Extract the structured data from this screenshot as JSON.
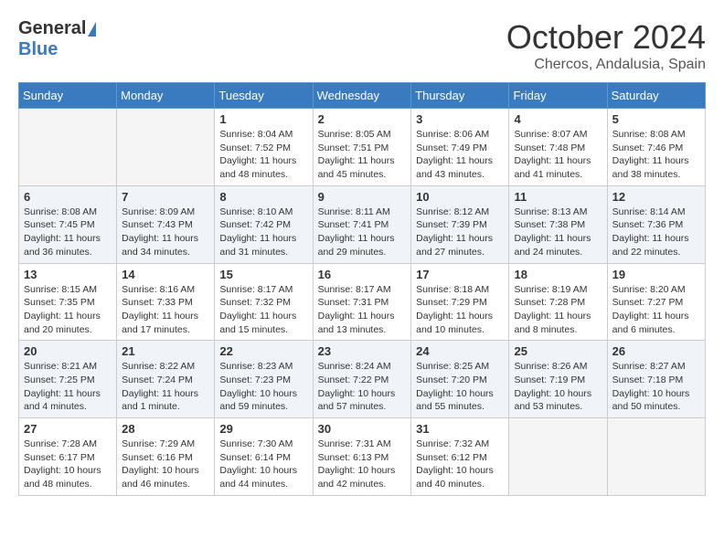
{
  "logo": {
    "line1": "General",
    "line2": "Blue"
  },
  "title": "October 2024",
  "location": "Chercos, Andalusia, Spain",
  "weekdays": [
    "Sunday",
    "Monday",
    "Tuesday",
    "Wednesday",
    "Thursday",
    "Friday",
    "Saturday"
  ],
  "weeks": [
    [
      {
        "day": "",
        "info": ""
      },
      {
        "day": "",
        "info": ""
      },
      {
        "day": "1",
        "info": "Sunrise: 8:04 AM\nSunset: 7:52 PM\nDaylight: 11 hours and 48 minutes."
      },
      {
        "day": "2",
        "info": "Sunrise: 8:05 AM\nSunset: 7:51 PM\nDaylight: 11 hours and 45 minutes."
      },
      {
        "day": "3",
        "info": "Sunrise: 8:06 AM\nSunset: 7:49 PM\nDaylight: 11 hours and 43 minutes."
      },
      {
        "day": "4",
        "info": "Sunrise: 8:07 AM\nSunset: 7:48 PM\nDaylight: 11 hours and 41 minutes."
      },
      {
        "day": "5",
        "info": "Sunrise: 8:08 AM\nSunset: 7:46 PM\nDaylight: 11 hours and 38 minutes."
      }
    ],
    [
      {
        "day": "6",
        "info": "Sunrise: 8:08 AM\nSunset: 7:45 PM\nDaylight: 11 hours and 36 minutes."
      },
      {
        "day": "7",
        "info": "Sunrise: 8:09 AM\nSunset: 7:43 PM\nDaylight: 11 hours and 34 minutes."
      },
      {
        "day": "8",
        "info": "Sunrise: 8:10 AM\nSunset: 7:42 PM\nDaylight: 11 hours and 31 minutes."
      },
      {
        "day": "9",
        "info": "Sunrise: 8:11 AM\nSunset: 7:41 PM\nDaylight: 11 hours and 29 minutes."
      },
      {
        "day": "10",
        "info": "Sunrise: 8:12 AM\nSunset: 7:39 PM\nDaylight: 11 hours and 27 minutes."
      },
      {
        "day": "11",
        "info": "Sunrise: 8:13 AM\nSunset: 7:38 PM\nDaylight: 11 hours and 24 minutes."
      },
      {
        "day": "12",
        "info": "Sunrise: 8:14 AM\nSunset: 7:36 PM\nDaylight: 11 hours and 22 minutes."
      }
    ],
    [
      {
        "day": "13",
        "info": "Sunrise: 8:15 AM\nSunset: 7:35 PM\nDaylight: 11 hours and 20 minutes."
      },
      {
        "day": "14",
        "info": "Sunrise: 8:16 AM\nSunset: 7:33 PM\nDaylight: 11 hours and 17 minutes."
      },
      {
        "day": "15",
        "info": "Sunrise: 8:17 AM\nSunset: 7:32 PM\nDaylight: 11 hours and 15 minutes."
      },
      {
        "day": "16",
        "info": "Sunrise: 8:17 AM\nSunset: 7:31 PM\nDaylight: 11 hours and 13 minutes."
      },
      {
        "day": "17",
        "info": "Sunrise: 8:18 AM\nSunset: 7:29 PM\nDaylight: 11 hours and 10 minutes."
      },
      {
        "day": "18",
        "info": "Sunrise: 8:19 AM\nSunset: 7:28 PM\nDaylight: 11 hours and 8 minutes."
      },
      {
        "day": "19",
        "info": "Sunrise: 8:20 AM\nSunset: 7:27 PM\nDaylight: 11 hours and 6 minutes."
      }
    ],
    [
      {
        "day": "20",
        "info": "Sunrise: 8:21 AM\nSunset: 7:25 PM\nDaylight: 11 hours and 4 minutes."
      },
      {
        "day": "21",
        "info": "Sunrise: 8:22 AM\nSunset: 7:24 PM\nDaylight: 11 hours and 1 minute."
      },
      {
        "day": "22",
        "info": "Sunrise: 8:23 AM\nSunset: 7:23 PM\nDaylight: 10 hours and 59 minutes."
      },
      {
        "day": "23",
        "info": "Sunrise: 8:24 AM\nSunset: 7:22 PM\nDaylight: 10 hours and 57 minutes."
      },
      {
        "day": "24",
        "info": "Sunrise: 8:25 AM\nSunset: 7:20 PM\nDaylight: 10 hours and 55 minutes."
      },
      {
        "day": "25",
        "info": "Sunrise: 8:26 AM\nSunset: 7:19 PM\nDaylight: 10 hours and 53 minutes."
      },
      {
        "day": "26",
        "info": "Sunrise: 8:27 AM\nSunset: 7:18 PM\nDaylight: 10 hours and 50 minutes."
      }
    ],
    [
      {
        "day": "27",
        "info": "Sunrise: 7:28 AM\nSunset: 6:17 PM\nDaylight: 10 hours and 48 minutes."
      },
      {
        "day": "28",
        "info": "Sunrise: 7:29 AM\nSunset: 6:16 PM\nDaylight: 10 hours and 46 minutes."
      },
      {
        "day": "29",
        "info": "Sunrise: 7:30 AM\nSunset: 6:14 PM\nDaylight: 10 hours and 44 minutes."
      },
      {
        "day": "30",
        "info": "Sunrise: 7:31 AM\nSunset: 6:13 PM\nDaylight: 10 hours and 42 minutes."
      },
      {
        "day": "31",
        "info": "Sunrise: 7:32 AM\nSunset: 6:12 PM\nDaylight: 10 hours and 40 minutes."
      },
      {
        "day": "",
        "info": ""
      },
      {
        "day": "",
        "info": ""
      }
    ]
  ]
}
